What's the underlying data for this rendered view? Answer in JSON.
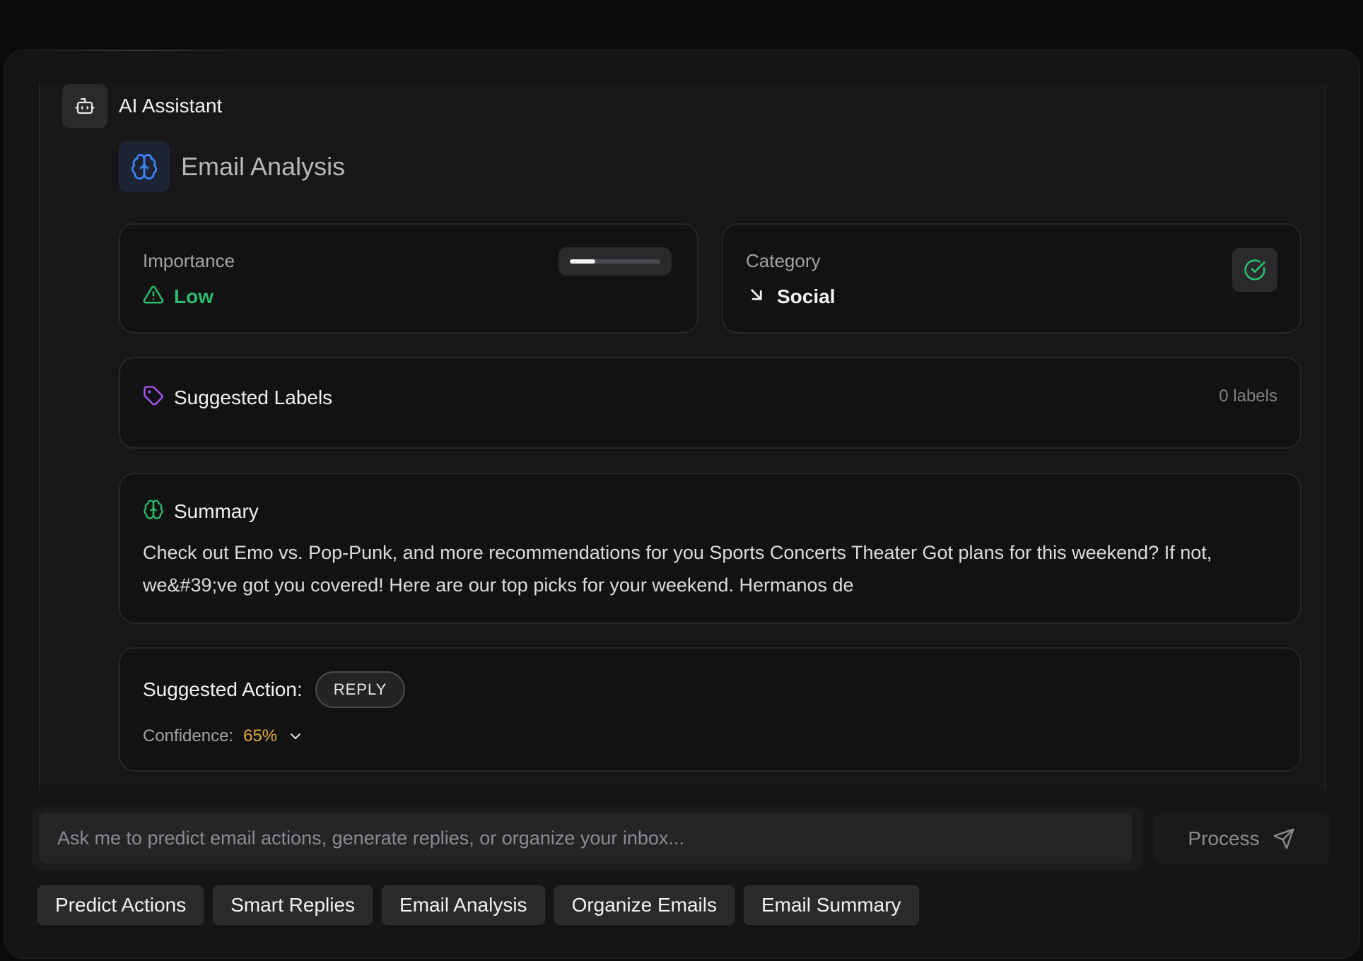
{
  "assistant": {
    "title": "AI Assistant",
    "icon": "bot-icon"
  },
  "analysis": {
    "title": "Email Analysis",
    "icon": "brain-icon"
  },
  "importance": {
    "label": "Importance",
    "value": "Low",
    "level": 0.28,
    "color": "#2bbd6e"
  },
  "category": {
    "label": "Category",
    "value": "Social"
  },
  "labels": {
    "title": "Suggested Labels",
    "count": "0 labels"
  },
  "summary": {
    "title": "Summary",
    "text": "Check out Emo vs. Pop-Punk, and more recommendations for you Sports Concerts Theater Got plans for this weekend? If not, we&#39;ve got you covered! Here are our top picks for your weekend. Hermanos de"
  },
  "action": {
    "label": "Suggested Action:",
    "value": "REPLY",
    "confidence_label": "Confidence:",
    "confidence_value": "65%",
    "confidence_color": "#e0a93b"
  },
  "input": {
    "placeholder": "Ask me to predict email actions, generate replies, or organize your inbox...",
    "value": ""
  },
  "process": {
    "label": "Process"
  },
  "quick_actions": [
    "Predict Actions",
    "Smart Replies",
    "Email Analysis",
    "Organize Emails",
    "Email Summary"
  ]
}
